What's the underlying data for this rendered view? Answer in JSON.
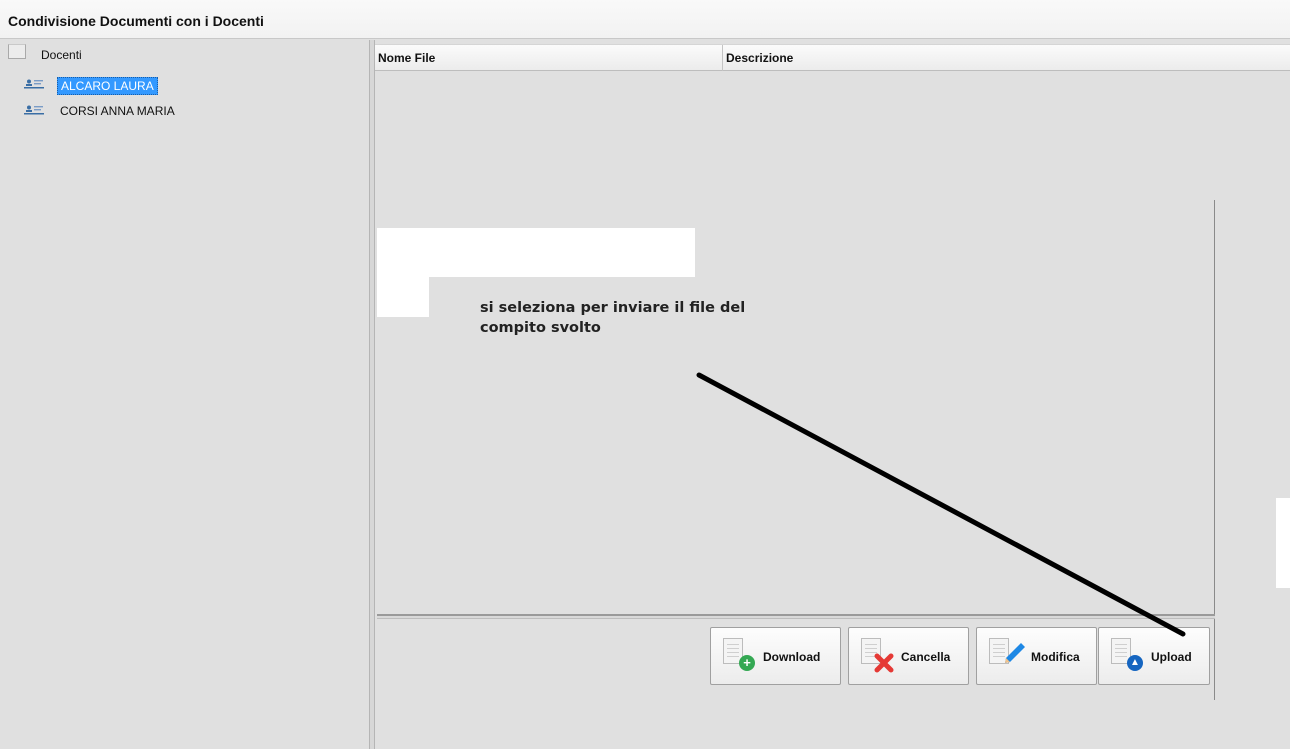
{
  "window": {
    "title": "Condivisione Documenti con i Docenti"
  },
  "tree": {
    "root_label": "Docenti",
    "items": [
      {
        "label": "ALCARO LAURA",
        "selected": true
      },
      {
        "label": "CORSI ANNA MARIA",
        "selected": false
      }
    ]
  },
  "table": {
    "columns": [
      "Nome File",
      "Descrizione"
    ],
    "rows": []
  },
  "annotation": {
    "line1": "si seleziona per inviare il file del",
    "line2": "compito svolto"
  },
  "buttons": {
    "download": "Download",
    "cancella": "Cancella",
    "modifica": "Modifica",
    "upload": "Upload"
  },
  "colors": {
    "selection": "#3399ff",
    "download_badge": "#34a853",
    "cancella_x": "#e53935",
    "modifica_pencil": "#1e88e5",
    "upload_badge": "#1565c0"
  }
}
